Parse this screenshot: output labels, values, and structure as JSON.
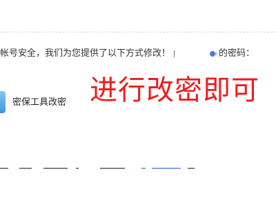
{
  "intro": {
    "prefix": "帐号安全，我们为您提供了以下方式修改！",
    "suffix": "的密码："
  },
  "method": {
    "label": "密保工具改密"
  },
  "annotation": {
    "text": "进行改密即可"
  },
  "colors": {
    "annotation": "#ee1c1c",
    "method_icon": "#3d97dd",
    "text": "#333333"
  }
}
